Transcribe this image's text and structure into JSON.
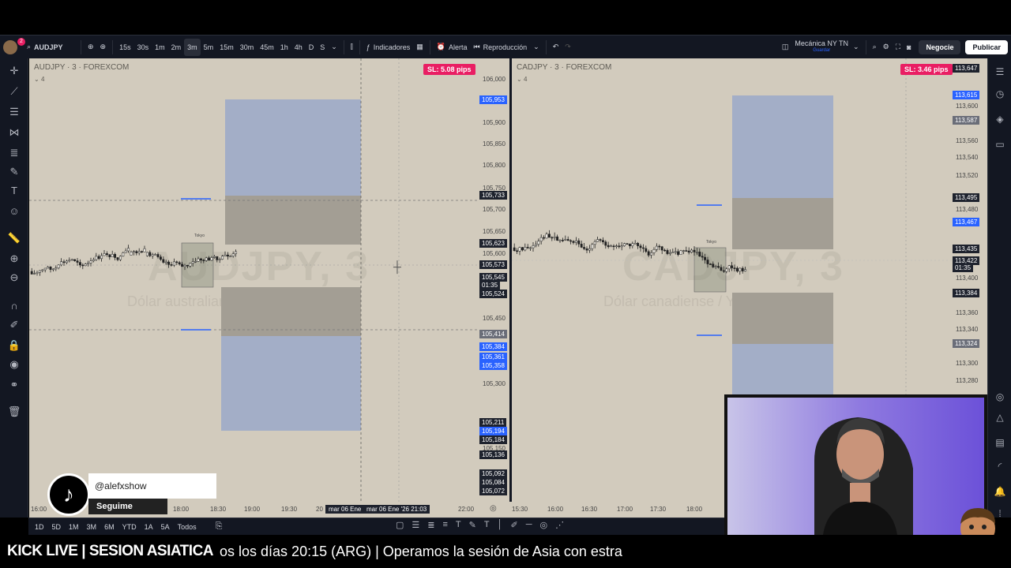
{
  "toolbar": {
    "symbol": "AUDJPY",
    "intervals": [
      "15s",
      "30s",
      "1m",
      "2m",
      "3m",
      "5m",
      "15m",
      "30m",
      "45m",
      "1h",
      "4h",
      "D",
      "S"
    ],
    "active_interval": "3m",
    "indicators_label": "Indicadores",
    "alert_label": "Alerta",
    "replay_label": "Reproducción",
    "layout_name": "Mecánica NY TN",
    "layout_status": "Guardar",
    "trade_label": "Negocie",
    "publish_label": "Publicar",
    "notification_count": "2"
  },
  "left_chart": {
    "title": "AUDJPY · 3 · FOREXCOM",
    "legend_count": "4",
    "watermark": "AUDJPY, 3",
    "watermark_sub": "Dólar australiano / Yen japonés",
    "sl_badge": "SL: 5.08 pips",
    "session_label": "Tokyo",
    "price_ticks": [
      "106,000",
      "105,900",
      "105,850",
      "105,800",
      "105,750",
      "105,700",
      "105,650",
      "105,600",
      "105,450",
      "105,300",
      "105,150"
    ],
    "price_tags": [
      {
        "text": "105,953",
        "style": "blue"
      },
      {
        "text": "105,733",
        "style": "dark"
      },
      {
        "text": "105,623",
        "style": "dark"
      },
      {
        "text": "105,573",
        "style": "dark"
      },
      {
        "text": "105,545",
        "style": "dark"
      },
      {
        "text": "01:35",
        "style": "dark"
      },
      {
        "text": "105,524",
        "style": "dark"
      },
      {
        "text": "105,414",
        "style": "gray"
      },
      {
        "text": "105,384",
        "style": "blue"
      },
      {
        "text": "105,361",
        "style": "blue"
      },
      {
        "text": "105,358",
        "style": "blue"
      },
      {
        "text": "105,211",
        "style": "dark"
      },
      {
        "text": "105,194",
        "style": "blue"
      },
      {
        "text": "105,184",
        "style": "dark"
      },
      {
        "text": "105,136",
        "style": "dark"
      },
      {
        "text": "105,092",
        "style": "dark"
      },
      {
        "text": "105,084",
        "style": "dark"
      },
      {
        "text": "105,072",
        "style": "dark"
      }
    ],
    "time_ticks": [
      "16:00",
      "18:00",
      "18:30",
      "19:00",
      "19:30",
      "20",
      "22:00"
    ],
    "crosshair_time_1": "mar 06 Ene",
    "crosshair_time_2": "mar 06 Ene '26  21:03"
  },
  "right_chart": {
    "title": "CADJPY · 3 · FOREXCOM",
    "legend_count": "4",
    "watermark": "CADJPY, 3",
    "watermark_sub": "Dólar canadiense / Yen japonés",
    "sl_badge": "SL: 3.46 pips",
    "session_label": "Tokyo",
    "price_ticks": [
      "113,600",
      "113,560",
      "113,540",
      "113,520",
      "113,480",
      "113,400",
      "113,360",
      "113,340",
      "113,300",
      "113,280"
    ],
    "price_tags": [
      {
        "text": "113,647",
        "style": "dark"
      },
      {
        "text": "113,615",
        "style": "blue"
      },
      {
        "text": "113,587",
        "style": "gray"
      },
      {
        "text": "113,495",
        "style": "dark"
      },
      {
        "text": "113,467",
        "style": "blue"
      },
      {
        "text": "113,435",
        "style": "dark"
      },
      {
        "text": "113,422",
        "style": "dark"
      },
      {
        "text": "01:35",
        "style": "dark"
      },
      {
        "text": "113,384",
        "style": "dark"
      },
      {
        "text": "113,324",
        "style": "gray"
      }
    ],
    "time_ticks": [
      "15:30",
      "16:00",
      "16:30",
      "17:00",
      "17:30",
      "18:00"
    ]
  },
  "timeframes": [
    "1D",
    "5D",
    "1M",
    "3M",
    "6M",
    "YTD",
    "1A",
    "5A",
    "Todos"
  ],
  "tiktok": {
    "handle": "@alefxshow",
    "follow": "Seguime"
  },
  "stream": {
    "title": "KICK LIVE | SESION ASIATICA",
    "ticker": "os los días 20:15 (ARG) | Operamos la sesión de Asia con estra"
  },
  "colors": {
    "chart_bg": "#d2cbbd",
    "zone_blue": "#a3aec7",
    "zone_gray": "#a39e94",
    "sl_pink": "#e91e63",
    "accent_blue": "#2962ff"
  }
}
